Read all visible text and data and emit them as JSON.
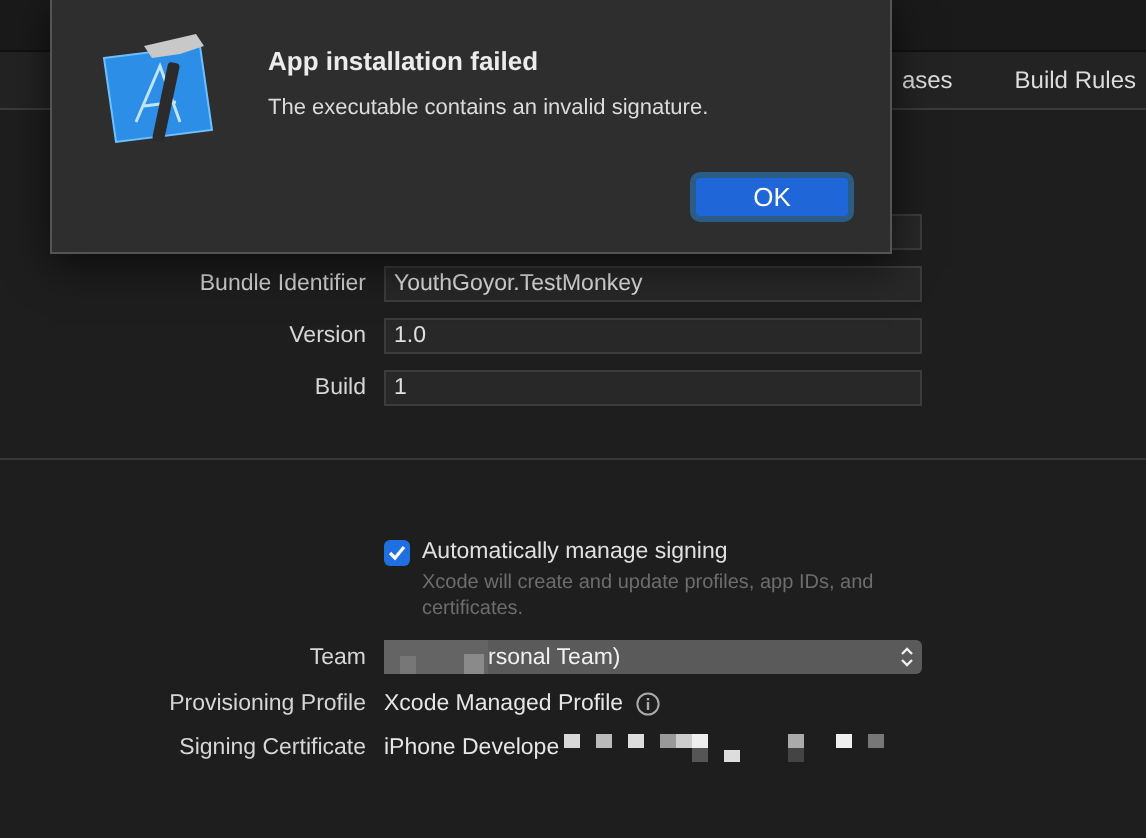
{
  "tabs": [
    {
      "label": "ases",
      "selected": false
    },
    {
      "label": "Build Rules",
      "selected": false
    }
  ],
  "identity": [
    {
      "kind": "field"
    },
    {
      "kind": "field",
      "label": "Bundle Identifier",
      "value": "YouthGoyor.TestMonkey"
    },
    {
      "kind": "field",
      "label": "Version",
      "value": "1.0"
    },
    {
      "kind": "field",
      "label": "Build",
      "value": "1"
    }
  ],
  "signing": {
    "auto": {
      "label": "Automatically manage signing",
      "checked": true,
      "hint": "Xcode will create and update profiles, app IDs, and certificates."
    },
    "team": {
      "label": "Team",
      "value": "rsonal Team)"
    },
    "profile": {
      "label": "Provisioning Profile",
      "value": "Xcode Managed Profile"
    },
    "certificate": {
      "label": "Signing Certificate",
      "value": "iPhone Develope"
    }
  },
  "alert": {
    "title": "App installation failed",
    "message": "The executable contains an invalid signature.",
    "button": "OK"
  }
}
